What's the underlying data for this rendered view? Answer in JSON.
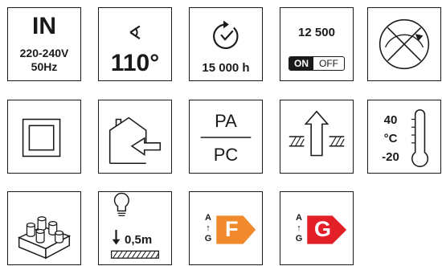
{
  "tiles": {
    "input": {
      "label": "IN",
      "voltage": "220-240V",
      "frequency": "50Hz"
    },
    "beam_angle": {
      "value": "110°"
    },
    "lifetime": {
      "value": "15 000 h"
    },
    "switching": {
      "cycles": "12 500",
      "on": "ON",
      "off": "OFF"
    },
    "not_dimmable": {
      "icon": "no-dimming-icon"
    },
    "protection_class": {
      "icon": "double-insulation-icon"
    },
    "indoor_use": {
      "icon": "indoor-house-arrow-icon"
    },
    "material": {
      "top": "PA",
      "bottom": "PC"
    },
    "installation": {
      "icon": "flush-mount-arrow-icon"
    },
    "temperature": {
      "max": "40",
      "unit": "°C",
      "min": "-20"
    },
    "package": {
      "icon": "multipack-icon"
    },
    "mount_distance": {
      "value": "0,5m"
    },
    "energy_f": {
      "top": "A",
      "bottom": "G",
      "letter": "F",
      "color": "#f08a2c"
    },
    "energy_g": {
      "top": "A",
      "bottom": "G",
      "letter": "G",
      "color": "#e32027"
    }
  }
}
